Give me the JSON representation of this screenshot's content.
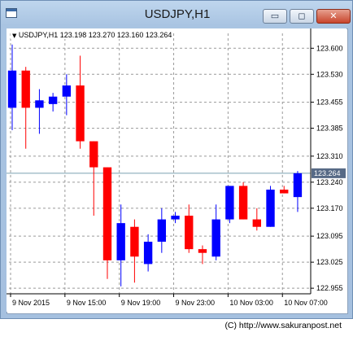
{
  "window": {
    "title": "USDJPY,H1",
    "buttons": {
      "minimize": "▭",
      "maximize": "◻",
      "close": "✕"
    }
  },
  "chart_info": "USDJPY,H1  123.198 123.270 123.160 123.264",
  "chart_info_arrow": "▼",
  "colors": {
    "bull_candle": "#0000ff",
    "bear_candle": "#ff0000",
    "grid": "#9a9a9a",
    "price_line": "#7aa0b0",
    "price_label_bg": "#576a86"
  },
  "chart_data": {
    "type": "candlestick",
    "symbol": "USDJPY",
    "timeframe": "H1",
    "ylim": [
      122.94,
      123.64
    ],
    "y_ticks": [
      "123.600",
      "123.530",
      "123.455",
      "123.385",
      "123.310",
      "123.240",
      "123.170",
      "123.095",
      "123.025",
      "122.955"
    ],
    "x_ticks": [
      "9 Nov 2015",
      "9 Nov 15:00",
      "9 Nov 19:00",
      "9 Nov 23:00",
      "10 Nov 03:00",
      "10 Nov 07:00"
    ],
    "current_price": "123.264",
    "candles": [
      {
        "o": 123.44,
        "h": 123.61,
        "l": 123.38,
        "c": 123.54
      },
      {
        "o": 123.54,
        "h": 123.55,
        "l": 123.33,
        "c": 123.44
      },
      {
        "o": 123.44,
        "h": 123.49,
        "l": 123.37,
        "c": 123.46
      },
      {
        "o": 123.45,
        "h": 123.48,
        "l": 123.43,
        "c": 123.47
      },
      {
        "o": 123.47,
        "h": 123.53,
        "l": 123.42,
        "c": 123.5
      },
      {
        "o": 123.5,
        "h": 123.58,
        "l": 123.33,
        "c": 123.35
      },
      {
        "o": 123.35,
        "h": 123.35,
        "l": 123.15,
        "c": 123.28
      },
      {
        "o": 123.28,
        "h": 123.28,
        "l": 122.98,
        "c": 123.03
      },
      {
        "o": 123.03,
        "h": 123.18,
        "l": 122.96,
        "c": 123.13
      },
      {
        "o": 123.12,
        "h": 123.14,
        "l": 122.97,
        "c": 123.04
      },
      {
        "o": 123.02,
        "h": 123.1,
        "l": 123.0,
        "c": 123.08
      },
      {
        "o": 123.08,
        "h": 123.17,
        "l": 123.05,
        "c": 123.14
      },
      {
        "o": 123.14,
        "h": 123.16,
        "l": 123.13,
        "c": 123.15
      },
      {
        "o": 123.15,
        "h": 123.18,
        "l": 123.05,
        "c": 123.06
      },
      {
        "o": 123.06,
        "h": 123.07,
        "l": 123.02,
        "c": 123.05
      },
      {
        "o": 123.04,
        "h": 123.18,
        "l": 123.03,
        "c": 123.14
      },
      {
        "o": 123.14,
        "h": 123.23,
        "l": 123.13,
        "c": 123.23
      },
      {
        "o": 123.23,
        "h": 123.24,
        "l": 123.14,
        "c": 123.14
      },
      {
        "o": 123.14,
        "h": 123.17,
        "l": 123.11,
        "c": 123.12
      },
      {
        "o": 123.12,
        "h": 123.23,
        "l": 123.12,
        "c": 123.22
      },
      {
        "o": 123.22,
        "h": 123.23,
        "l": 123.21,
        "c": 123.21
      },
      {
        "o": 123.2,
        "h": 123.27,
        "l": 123.16,
        "c": 123.264
      }
    ]
  },
  "footer": {
    "copyright": "(C) http://www.sakuranpost.net"
  }
}
